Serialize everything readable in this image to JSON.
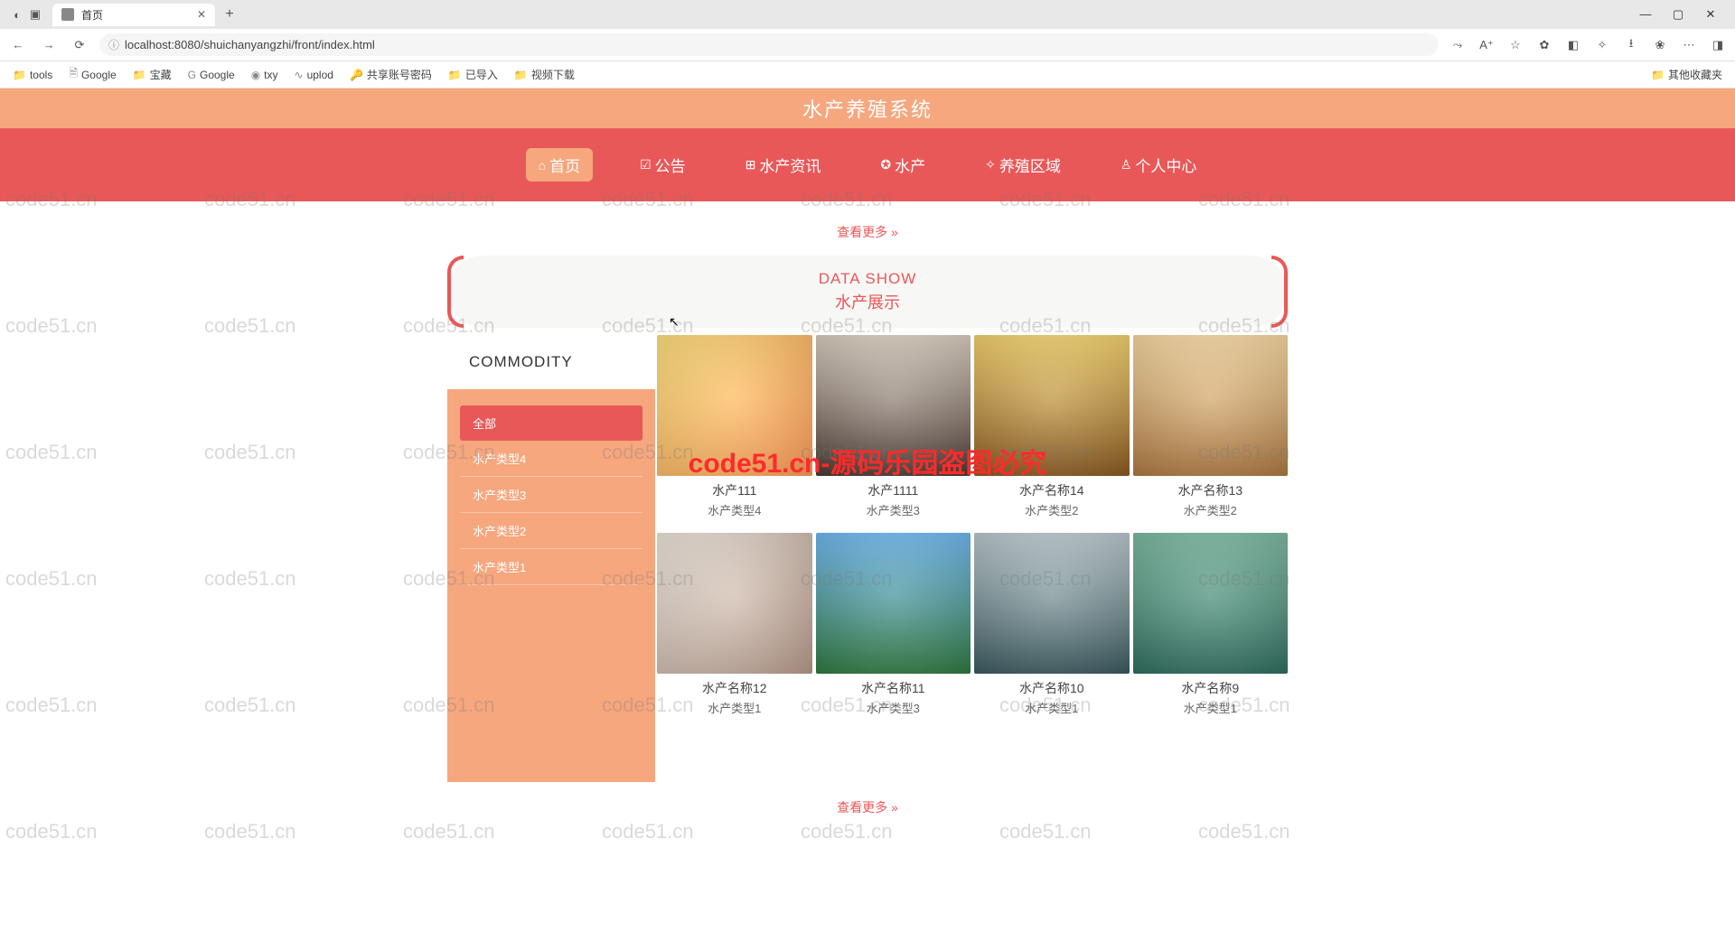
{
  "browser": {
    "tab_title": "首页",
    "url": "localhost:8080/shuichanyangzhi/front/index.html",
    "bookmarks": [
      "tools",
      "Google",
      "宝藏",
      "Google",
      "txy",
      "uplod",
      "共享账号密码",
      "已导入",
      "视频下载"
    ],
    "other_bookmarks": "其他收藏夹"
  },
  "site": {
    "title": "水产养殖系统",
    "nav": [
      {
        "icon": "⌂",
        "label": "首页",
        "active": true
      },
      {
        "icon": "☑",
        "label": "公告"
      },
      {
        "icon": "⊞",
        "label": "水产资讯"
      },
      {
        "icon": "✪",
        "label": "水产"
      },
      {
        "icon": "✧",
        "label": "养殖区域"
      },
      {
        "icon": "♙",
        "label": "个人中心"
      }
    ],
    "see_more": "查看更多 »",
    "data_show_en": "DATA SHOW",
    "data_show_cn": "水产展示",
    "sidebar_title": "COMMODITY",
    "categories": [
      "全部",
      "水产类型4",
      "水产类型3",
      "水产类型2",
      "水产类型1"
    ],
    "products": [
      {
        "name": "水产111",
        "type": "水产类型4",
        "bg": "linear-gradient(135deg,#ffe07a,#ff9a56)"
      },
      {
        "name": "水产1111",
        "type": "水产类型3",
        "bg": "linear-gradient(180deg,#d9cdbf,#4a3a32)"
      },
      {
        "name": "水产名称14",
        "type": "水产类型2",
        "bg": "linear-gradient(180deg,#f3d06a,#8a5a20)"
      },
      {
        "name": "水产名称13",
        "type": "水产类型2",
        "bg": "linear-gradient(180deg,#f6d7a0,#b07a40)"
      },
      {
        "name": "水产名称12",
        "type": "水产类型1",
        "bg": "linear-gradient(135deg,#eee6dc,#b89a8a)"
      },
      {
        "name": "水产名称11",
        "type": "水产类型3",
        "bg": "linear-gradient(180deg,#6db6ef,#2f7a3f)"
      },
      {
        "name": "水产名称10",
        "type": "水产类型1",
        "bg": "linear-gradient(180deg,#b9c7cc,#3a5a5f)"
      },
      {
        "name": "水产名称9",
        "type": "水产类型1",
        "bg": "linear-gradient(180deg,#7ab8a0,#2f6f5f)"
      }
    ],
    "watermark": "code51.cn",
    "overlay": "code51.cn-源码乐园盗图必究",
    "see_more_bottom": "查看更多 »"
  }
}
